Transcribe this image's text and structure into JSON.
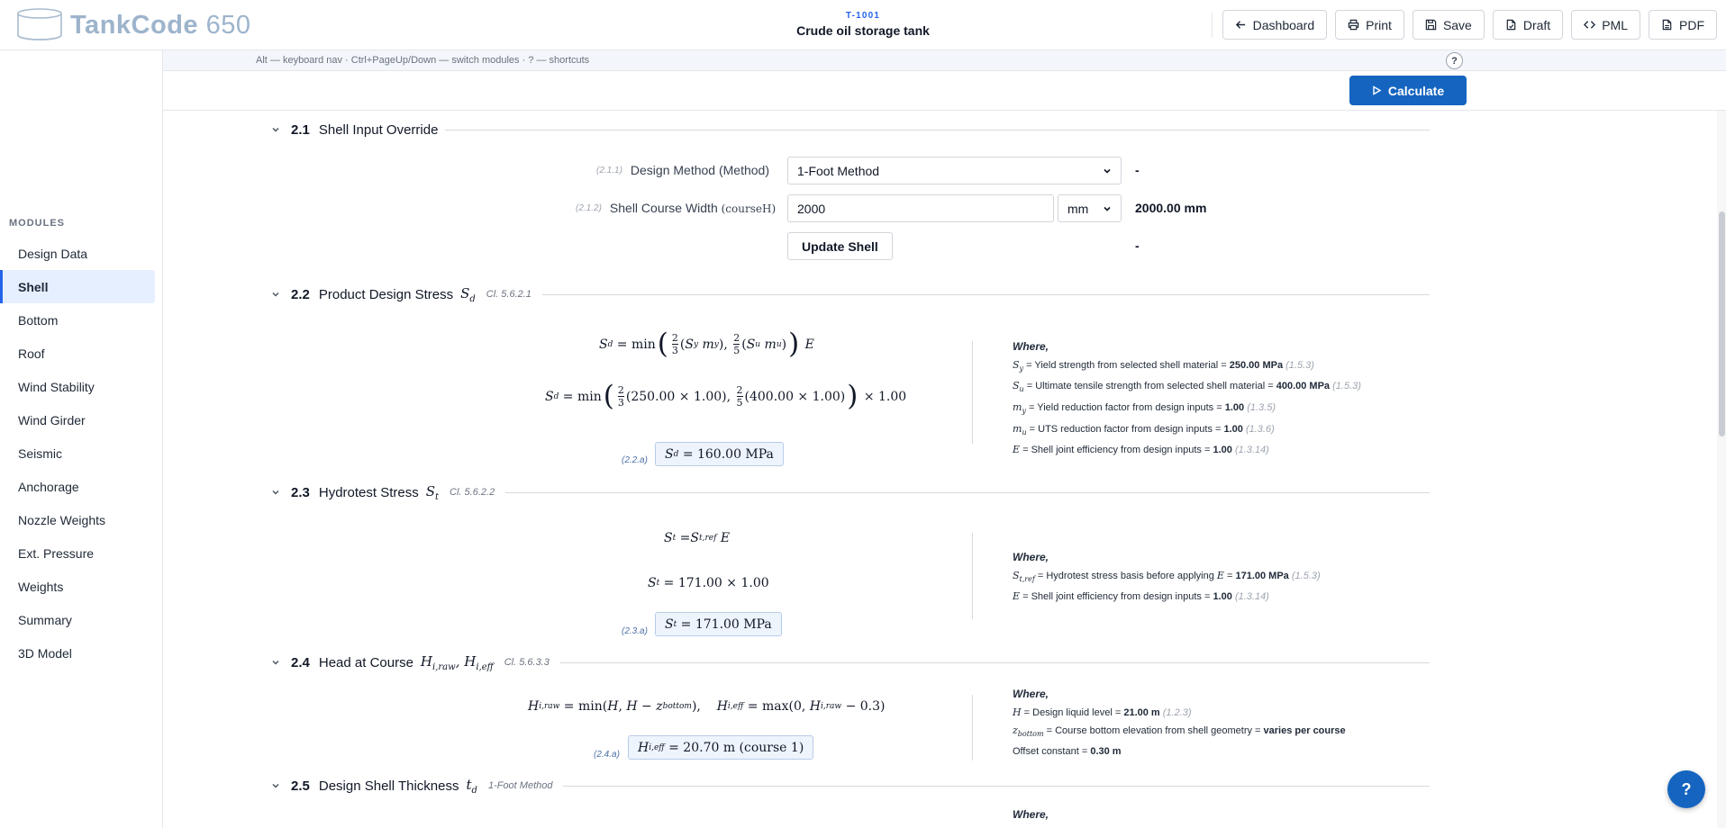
{
  "app": {
    "brand_word": "TankCode",
    "brand_num": "650"
  },
  "header": {
    "tag": "T-1001",
    "title": "Crude oil storage tank"
  },
  "toolbar": {
    "dashboard": "Dashboard",
    "print": "Print",
    "save": "Save",
    "draft": "Draft",
    "pml": "PML",
    "pdf": "PDF"
  },
  "hint": {
    "text": "Alt — keyboard nav · Ctrl+PageUp/Down — switch modules · ? — shortcuts",
    "help": "?"
  },
  "sidebar": {
    "heading": "MODULES",
    "items": [
      {
        "label": "Design Data"
      },
      {
        "label": "Shell"
      },
      {
        "label": "Bottom"
      },
      {
        "label": "Roof"
      },
      {
        "label": "Wind Stability"
      },
      {
        "label": "Wind Girder"
      },
      {
        "label": "Seismic"
      },
      {
        "label": "Anchorage"
      },
      {
        "label": "Nozzle Weights"
      },
      {
        "label": "Ext. Pressure"
      },
      {
        "label": "Weights"
      },
      {
        "label": "Summary"
      },
      {
        "label": "3D Model"
      }
    ]
  },
  "calculate_label": "Calculate",
  "s21": {
    "num": "2.1",
    "title": "Shell Input Override",
    "method": {
      "ref": "(2.1.1)",
      "label": "Design Method (Method)",
      "value": "1-Foot Method",
      "result": "-"
    },
    "width": {
      "ref": "(2.1.2)",
      "label": "Shell Course Width ",
      "sym": "(courseH)",
      "value": "2000",
      "unit": "mm",
      "result": "2000.00 mm"
    },
    "update_label": "Update Shell",
    "update_result": "-"
  },
  "s22": {
    "num": "2.2",
    "title": "Product Design Stress",
    "clause": "Cl. 5.6.2.1",
    "eq": {
      "a": "250.00 × 1.00",
      "b": "400.00 × 1.00",
      "c": "× 1.00"
    },
    "result": {
      "ref": "(2.2.a)",
      "text": "= 160.00 MPa"
    },
    "where": {
      "heading": "Where,",
      "l1": {
        "text": " = Yield strength from selected shell material = ",
        "value": "250.00 MPa",
        "ref": "(1.5.3)"
      },
      "l2": {
        "text": " = Ultimate tensile strength from selected shell material = ",
        "value": "400.00 MPa",
        "ref": "(1.5.3)"
      },
      "l3": {
        "text": " = Yield reduction factor from design inputs = ",
        "value": "1.00",
        "ref": "(1.3.5)"
      },
      "l4": {
        "text": " = UTS reduction factor from design inputs = ",
        "value": "1.00",
        "ref": "(1.3.6)"
      },
      "l5": {
        "text": " = Shell joint efficiency from design inputs = ",
        "value": "1.00",
        "ref": "(1.3.14)"
      }
    }
  },
  "s23": {
    "num": "2.3",
    "title": "Hydrotest Stress",
    "clause": "Cl. 5.6.2.2",
    "eq": {
      "rhs": "= 171.00 × 1.00"
    },
    "result": {
      "ref": "(2.3.a)",
      "text": "= 171.00 MPa"
    },
    "where": {
      "heading": "Where,",
      "l1": {
        "text": " = Hydrotest stress basis before applying ",
        "value": "171.00 MPa",
        "ref": "(1.5.3)"
      },
      "l2": {
        "text": " = Shell joint efficiency from design inputs = ",
        "value": "1.00",
        "ref": "(1.3.14)"
      }
    }
  },
  "s24": {
    "num": "2.4",
    "title": "Head at Course",
    "clause": "Cl. 5.6.3.3",
    "result": {
      "ref": "(2.4.a)",
      "text": "= 20.70 m (course 1)"
    },
    "where": {
      "heading": "Where,",
      "l1": {
        "text": " = Design liquid level = ",
        "value": "21.00 m",
        "ref": "(1.2.3)"
      },
      "l2": {
        "text": " = Course bottom elevation from shell geometry = ",
        "value": "varies per course"
      },
      "l3": {
        "text": "Offset constant = ",
        "value": "0.30 m"
      }
    }
  },
  "s25": {
    "num": "2.5",
    "title": "Design Shell Thickness",
    "clause": "1-Foot Method",
    "where_heading": "Where,"
  },
  "fab": "?"
}
